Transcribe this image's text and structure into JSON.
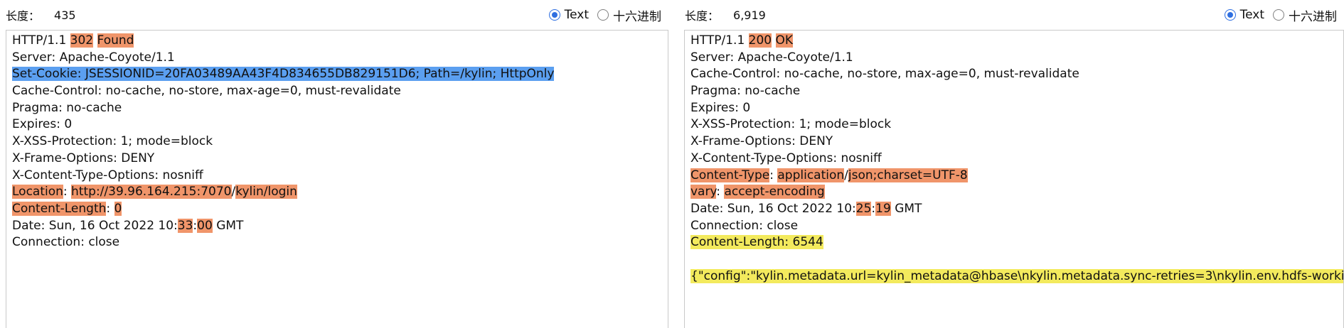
{
  "left": {
    "length_label": "长度：",
    "length_value": "435",
    "radio_text": "Text",
    "radio_hex": "十六进制",
    "lines": [
      [
        {
          "t": "HTTP/1.1 "
        },
        {
          "t": "302",
          "h": "or"
        },
        {
          "t": " "
        },
        {
          "t": "Found",
          "h": "or"
        }
      ],
      [
        {
          "t": "Server: Apache-Coyote/1.1"
        }
      ],
      [
        {
          "t": "Set-Cookie: JSESSIONID=20FA03489AA43F4D834655DB829151D6; Path=/kylin; HttpOnly",
          "h": "sel"
        }
      ],
      [
        {
          "t": "Cache-Control: no-cache, no-store, max-age=0, must-revalidate"
        }
      ],
      [
        {
          "t": "Pragma: no-cache"
        }
      ],
      [
        {
          "t": "Expires: 0"
        }
      ],
      [
        {
          "t": "X-XSS-Protection: 1; mode=block"
        }
      ],
      [
        {
          "t": "X-Frame-Options: DENY"
        }
      ],
      [
        {
          "t": "X-Content-Type-Options: nosniff"
        }
      ],
      [
        {
          "t": "Location",
          "h": "or"
        },
        {
          "t": ": "
        },
        {
          "t": "http://39.96.164.215:7070",
          "h": "or"
        },
        {
          "t": "/"
        },
        {
          "t": "kylin/login",
          "h": "or"
        }
      ],
      [
        {
          "t": "Content-Length",
          "h": "or"
        },
        {
          "t": ": "
        },
        {
          "t": "0",
          "h": "or"
        }
      ],
      [
        {
          "t": "Date: Sun, 16 Oct 2022 10:"
        },
        {
          "t": "33",
          "h": "or"
        },
        {
          "t": ":"
        },
        {
          "t": "00",
          "h": "or"
        },
        {
          "t": " GMT"
        }
      ],
      [
        {
          "t": "Connection: close"
        }
      ]
    ]
  },
  "right": {
    "length_label": "长度：",
    "length_value": "6,919",
    "radio_text": "Text",
    "radio_hex": "十六进制",
    "lines": [
      [
        {
          "t": "HTTP/1.1 "
        },
        {
          "t": "200",
          "h": "or"
        },
        {
          "t": " "
        },
        {
          "t": "OK",
          "h": "or"
        }
      ],
      [
        {
          "t": "Server: Apache-Coyote/1.1"
        }
      ],
      [
        {
          "t": "Cache-Control: no-cache, no-store, max-age=0, must-revalidate"
        }
      ],
      [
        {
          "t": "Pragma: no-cache"
        }
      ],
      [
        {
          "t": "Expires: 0"
        }
      ],
      [
        {
          "t": "X-XSS-Protection: 1; mode=block"
        }
      ],
      [
        {
          "t": "X-Frame-Options: DENY"
        }
      ],
      [
        {
          "t": "X-Content-Type-Options: nosniff"
        }
      ],
      [
        {
          "t": "Content-Type",
          "h": "or"
        },
        {
          "t": ": "
        },
        {
          "t": "application",
          "h": "or"
        },
        {
          "t": "/"
        },
        {
          "t": "json;charset=UTF-8",
          "h": "or"
        }
      ],
      [
        {
          "t": "vary",
          "h": "or"
        },
        {
          "t": ": "
        },
        {
          "t": "accept-encoding",
          "h": "or"
        }
      ],
      [
        {
          "t": "Date: Sun, 16 Oct 2022 10:"
        },
        {
          "t": "25",
          "h": "or"
        },
        {
          "t": ":"
        },
        {
          "t": "19",
          "h": "or"
        },
        {
          "t": " GMT"
        }
      ],
      [
        {
          "t": "Connection: close"
        }
      ],
      [
        {
          "t": "Content-Length: 6544",
          "h": "yl"
        }
      ],
      [],
      [
        {
          "t": "{\"config\":\"kylin.metadata.url=kylin_metadata@hbase\\nkylin.metadata.sync-retries=3\\nkylin.env.hdfs-working-dir=/kylin\\nkylin.env=QA",
          "h": "yl"
        }
      ]
    ]
  },
  "colors": {
    "diff_highlight": "#f0956a",
    "selection": "#5b9ff0",
    "search_highlight": "#f3ea5d",
    "radio_accent": "#2f6fe0"
  }
}
